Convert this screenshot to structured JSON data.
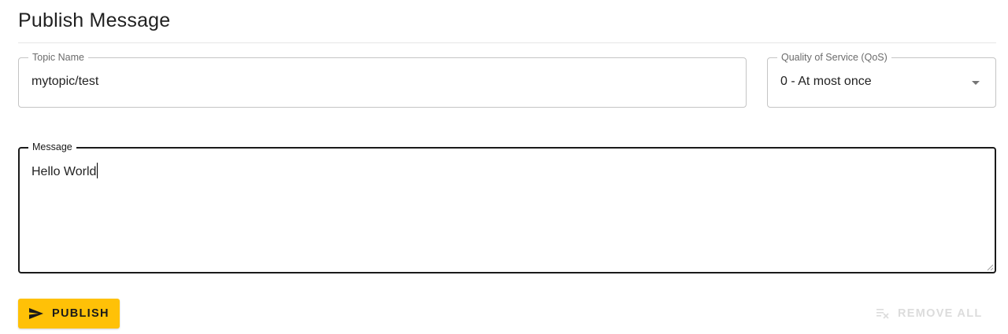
{
  "header": {
    "title": "Publish Message"
  },
  "form": {
    "topic": {
      "label": "Topic Name",
      "value": "mytopic/test"
    },
    "qos": {
      "label": "Quality of Service (QoS)",
      "selected": "0 - At most once"
    },
    "message": {
      "label": "Message",
      "value": "Hello World"
    }
  },
  "actions": {
    "publish_label": "PUBLISH",
    "remove_all_label": "REMOVE ALL"
  },
  "icons": {
    "publish": "send-icon",
    "remove_all": "clear-all-icon",
    "qos_dropdown": "arrow-drop-down-icon"
  },
  "colors": {
    "primary_button": "#ffc107",
    "disabled_text": "#dcdcdc",
    "focused_border": "#1a1a1a"
  }
}
